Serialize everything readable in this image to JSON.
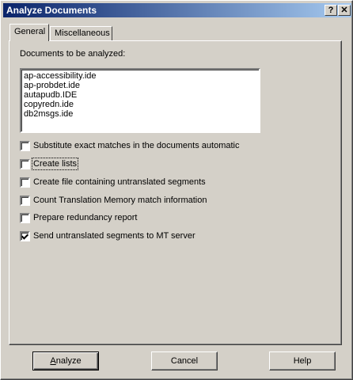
{
  "window": {
    "title": "Analyze Documents",
    "help_glyph": "?",
    "close_glyph": "✕"
  },
  "tabs": [
    {
      "label": "General",
      "active": true
    },
    {
      "label": "Miscellaneous",
      "active": false
    }
  ],
  "general": {
    "documents_label": "Documents to be analyzed:",
    "documents": [
      "ap-accessibility.ide",
      "ap-probdet.ide",
      "autapudb.IDE",
      "copyredn.ide",
      "db2msgs.ide"
    ],
    "options": [
      {
        "label": "Substitute exact matches in the documents automatic",
        "checked": false
      },
      {
        "label": "Create lists",
        "checked": false
      },
      {
        "label": "Create file containing untranslated segments",
        "checked": false
      },
      {
        "label": "Count Translation Memory match information",
        "checked": false
      },
      {
        "label": "Prepare redundancy report",
        "checked": false
      },
      {
        "label": "Send untranslated segments to MT server",
        "checked": true
      }
    ]
  },
  "buttons": {
    "analyze_first": "A",
    "analyze_rest": "nalyze",
    "cancel": "Cancel",
    "help": "Help"
  }
}
